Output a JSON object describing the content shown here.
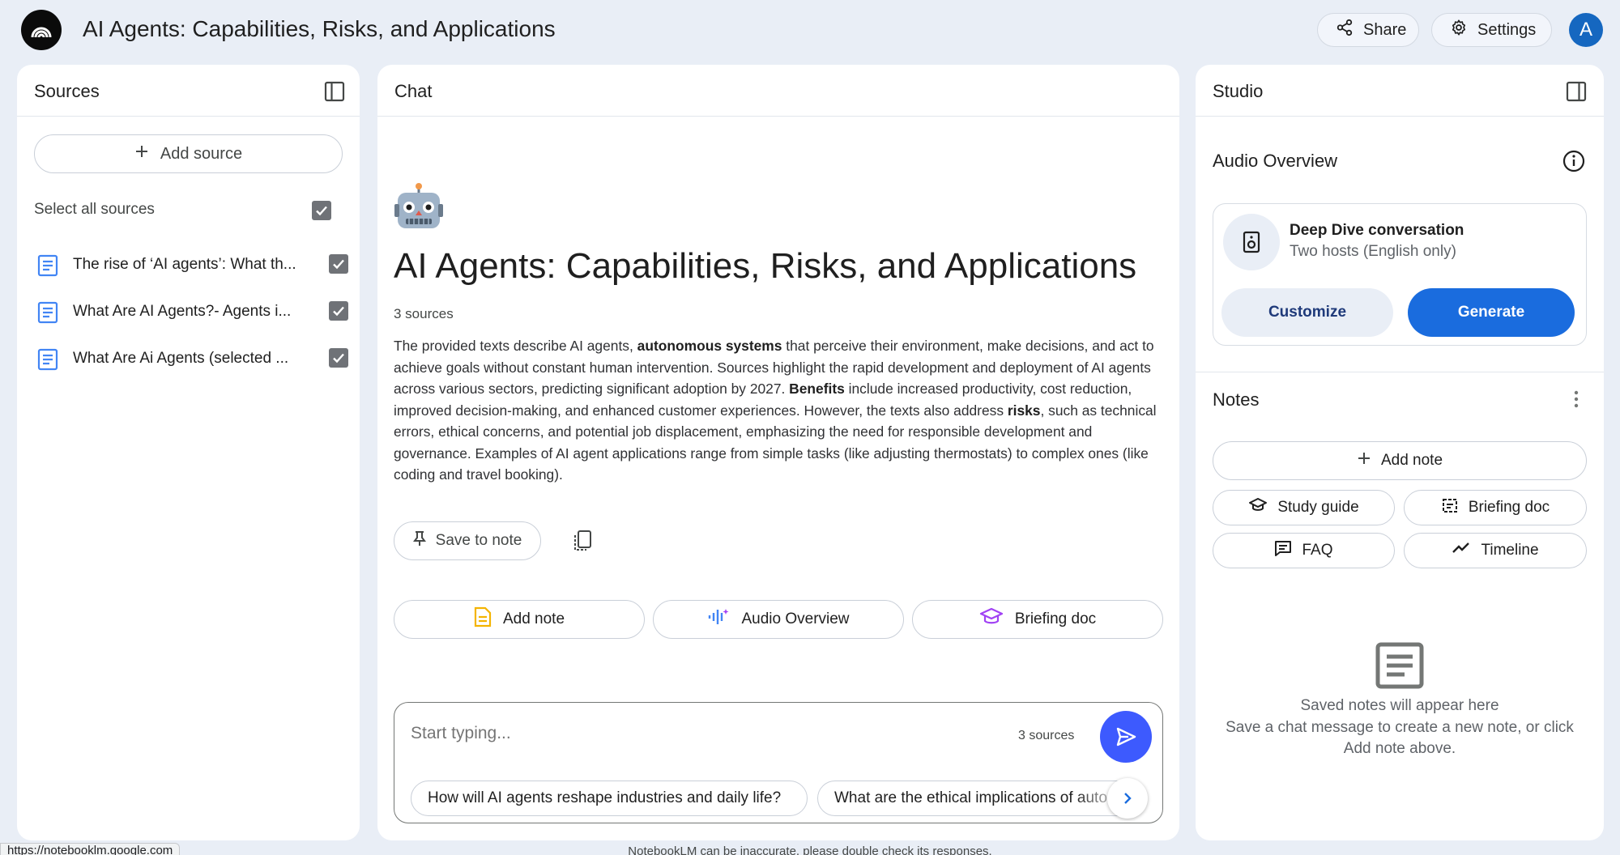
{
  "header": {
    "title": "AI Agents: Capabilities, Risks, and Applications",
    "share_label": "Share",
    "settings_label": "Settings",
    "avatar_initial": "A"
  },
  "sources": {
    "title": "Sources",
    "add_source_label": "Add source",
    "select_all_label": "Select all sources",
    "items": [
      {
        "label": "The rise of ‘AI agents’: What th..."
      },
      {
        "label": "What Are AI Agents?- Agents i..."
      },
      {
        "label": "What Are Ai Agents (selected ..."
      }
    ]
  },
  "chat": {
    "title": "Chat",
    "heading": "AI Agents: Capabilities, Risks, and Applications",
    "source_count": "3 sources",
    "summary": {
      "p1": "The provided texts describe AI agents, ",
      "b1": "autonomous systems",
      "p2": " that perceive their environment, make decisions, and act to achieve goals without constant human intervention. Sources highlight the rapid development and deployment of AI agents across various sectors, predicting significant adoption by 2027. ",
      "b2": "Benefits",
      "p3": " include increased productivity, cost reduction, improved decision-making, and enhanced customer experiences. However, the texts also address ",
      "b3": "risks",
      "p4": ", such as technical errors, ethical concerns, and potential job displacement, emphasizing the need for responsible development and governance. Examples of AI agent applications range from simple tasks (like adjusting thermostats) to complex ones (like coding and travel booking)."
    },
    "save_to_note_label": "Save to note",
    "chips": {
      "add_note": "Add note",
      "audio_overview": "Audio Overview",
      "briefing_doc": "Briefing doc"
    },
    "composer": {
      "placeholder": "Start typing...",
      "source_count": "3 sources"
    },
    "suggestions": [
      "How will AI agents reshape industries and daily life?",
      "What are the ethical implications of autonomous AI agents?"
    ]
  },
  "studio": {
    "title": "Studio",
    "audio_overview_title": "Audio Overview",
    "audio_card": {
      "title": "Deep Dive conversation",
      "subtitle": "Two hosts (English only)",
      "customize_label": "Customize",
      "generate_label": "Generate"
    },
    "notes_title": "Notes",
    "add_note_label": "Add note",
    "study_guide_label": "Study guide",
    "briefing_doc_label": "Briefing doc",
    "faq_label": "FAQ",
    "timeline_label": "Timeline",
    "empty_title": "Saved notes will appear here",
    "empty_body": "Save a chat message to create a new note, or click Add note above."
  },
  "footer": {
    "status_url": "https://notebooklm.google.com",
    "disclaimer": "NotebookLM can be inaccurate, please double check its responses."
  },
  "colors": {
    "background": "#e9eef6",
    "accent": "#1a6cde",
    "send_button": "#3d5afe",
    "doc_icon": "#4285f4",
    "add_note_icon": "#f4b400",
    "briefing_icon": "#a142f4"
  },
  "icons": [
    "logo-icon",
    "share-icon",
    "settings-icon",
    "panel-collapse-icon",
    "plus-icon",
    "checkbox-checked-icon",
    "document-icon",
    "robot-emoji",
    "pin-icon",
    "copy-icon",
    "note-icon",
    "audio-wave-icon",
    "graduation-cap-icon",
    "send-icon",
    "chevron-right-icon",
    "info-icon",
    "speaker-icon",
    "more-vert-icon",
    "calendar-doc-icon",
    "faq-icon",
    "trending-icon",
    "notes-empty-icon"
  ]
}
